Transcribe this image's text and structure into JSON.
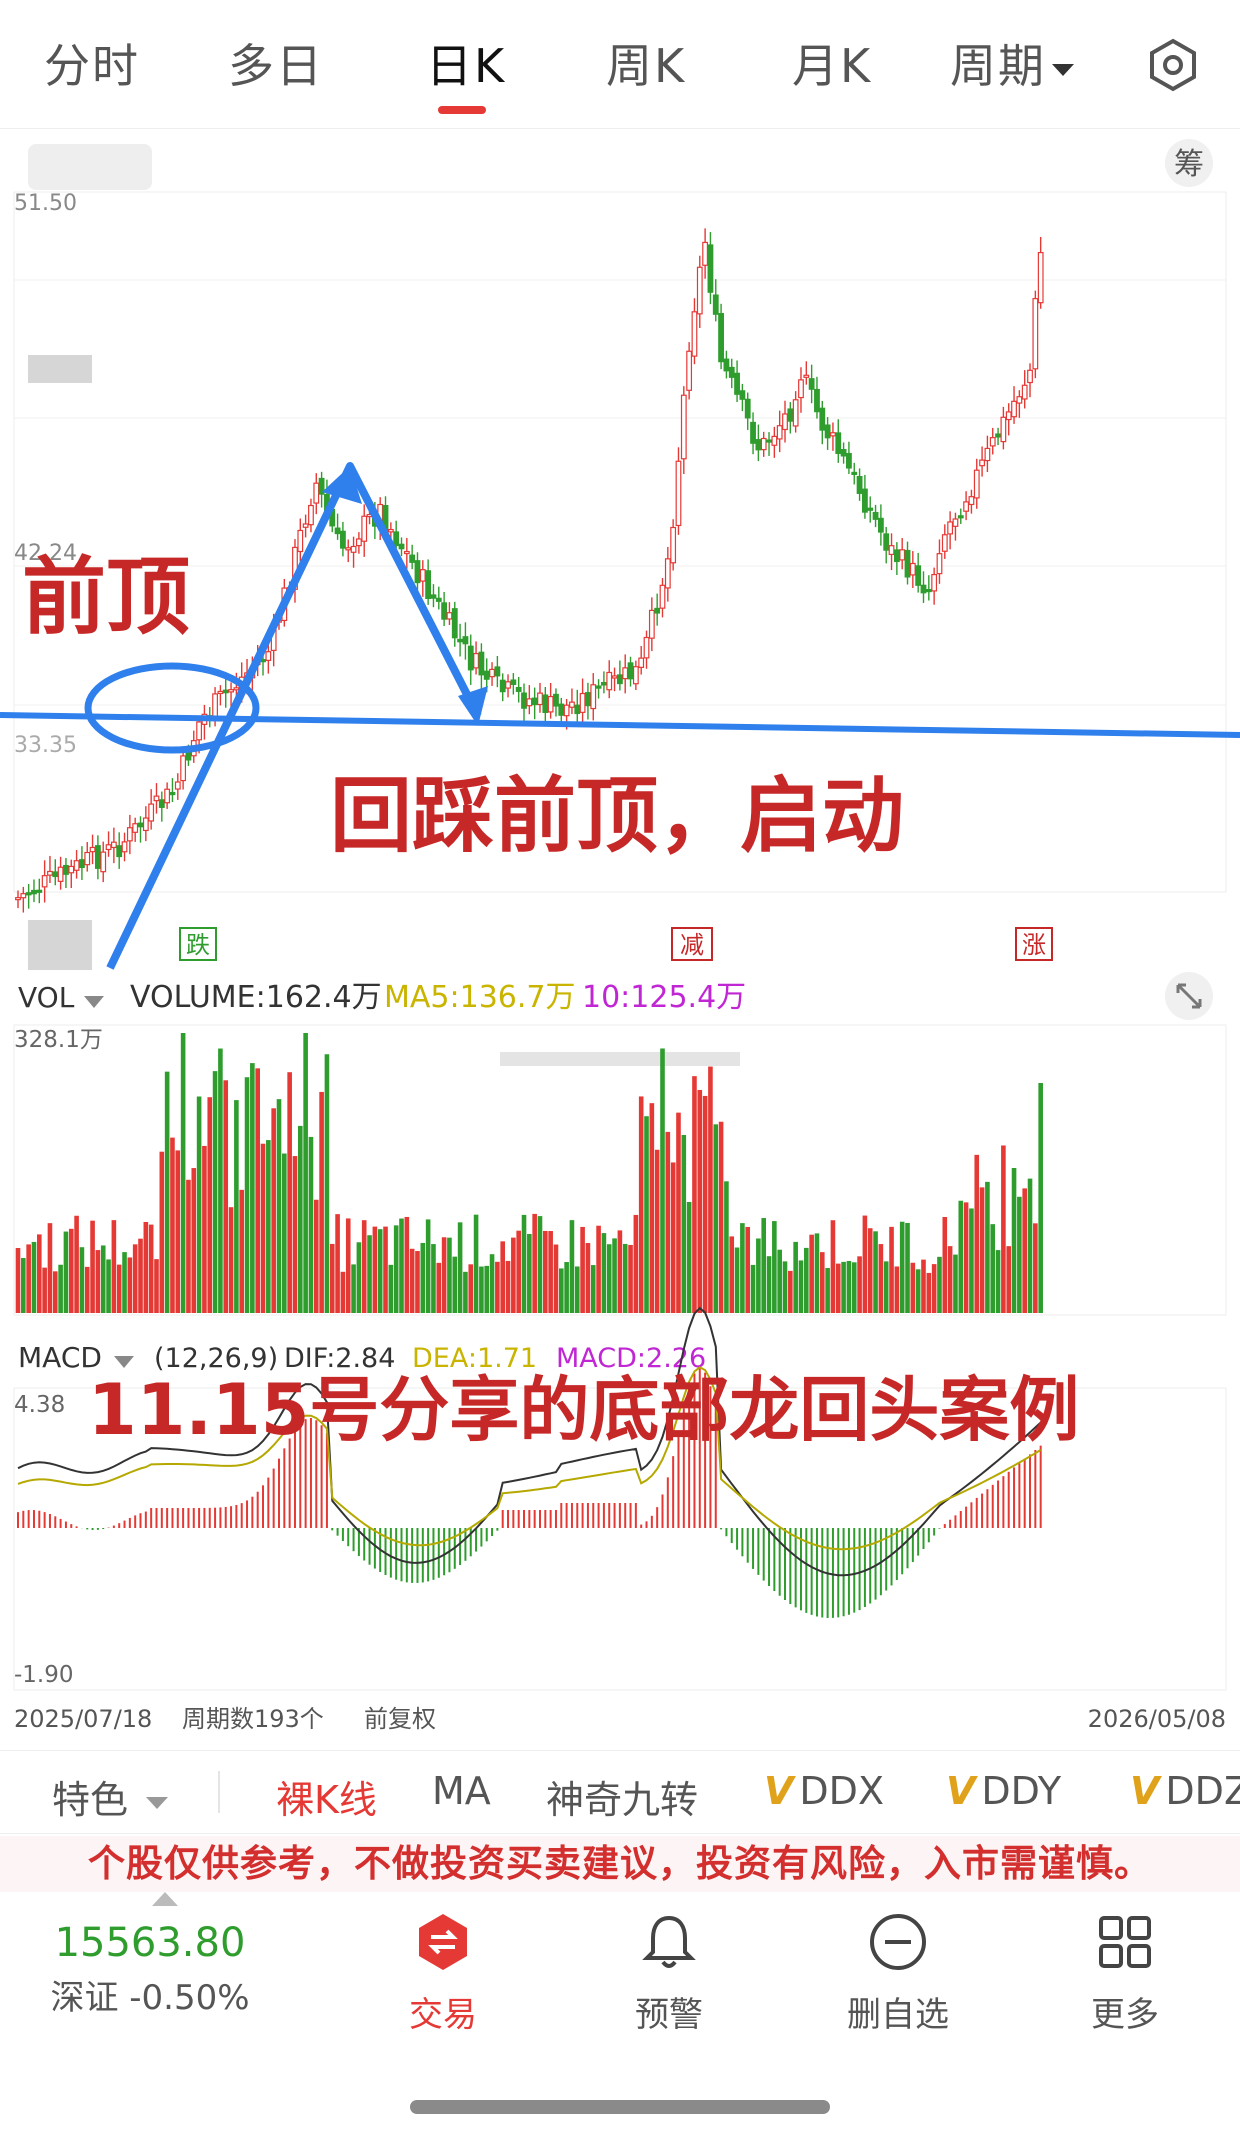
{
  "tabs": [
    {
      "label": "分时"
    },
    {
      "label": "多日"
    },
    {
      "label": "日K"
    },
    {
      "label": "周K"
    },
    {
      "label": "月K"
    },
    {
      "label": "周期"
    }
  ],
  "chip_button": "筹",
  "price_axis": {
    "top_label": "51.50",
    "mid_label": "42.24",
    "low_label": "33.35"
  },
  "annotations": {
    "prev_top": "前顶",
    "pullback": "回踩前顶，启动",
    "case_title": "11.15号分享的底部龙回头案例"
  },
  "event_markers": [
    "跌",
    "减",
    "涨"
  ],
  "volume": {
    "selector": "VOL",
    "volume_label": "VOLUME:162.4万",
    "ma5_label": "MA5:136.7万",
    "ma10_label": "10:125.4万",
    "max_label": "328.1万"
  },
  "macd": {
    "selector": "MACD",
    "params": "(12,26,9)",
    "dif": "DIF:2.84",
    "dea": "DEA:1.71",
    "macd": "MACD:2.26",
    "max_label": "4.38",
    "min_label": "-1.90"
  },
  "footer_axis": {
    "start_date": "2025/07/18",
    "period_count": "周期数193个",
    "adjust": "前复权",
    "end_date": "2026/05/08"
  },
  "indicator_bar": {
    "feature": "特色",
    "items": [
      "裸K线",
      "MA",
      "神奇九转",
      "DDX",
      "DDY",
      "DDZ"
    ]
  },
  "disclaimer": "个股仅供参考，不做投资买卖建议，投资有风险，入市需谨慎。",
  "bottom_nav": {
    "index_value": "15563.80",
    "index_name": "深证 -0.50%",
    "trade": "交易",
    "alert": "预警",
    "remove": "删自选",
    "more": "更多"
  },
  "colors": {
    "up": "#e53935",
    "down": "#2e9d2e",
    "annotation_blue": "#2f80ed",
    "ma5": "#c9b400",
    "ma10": "#c026d3"
  }
}
